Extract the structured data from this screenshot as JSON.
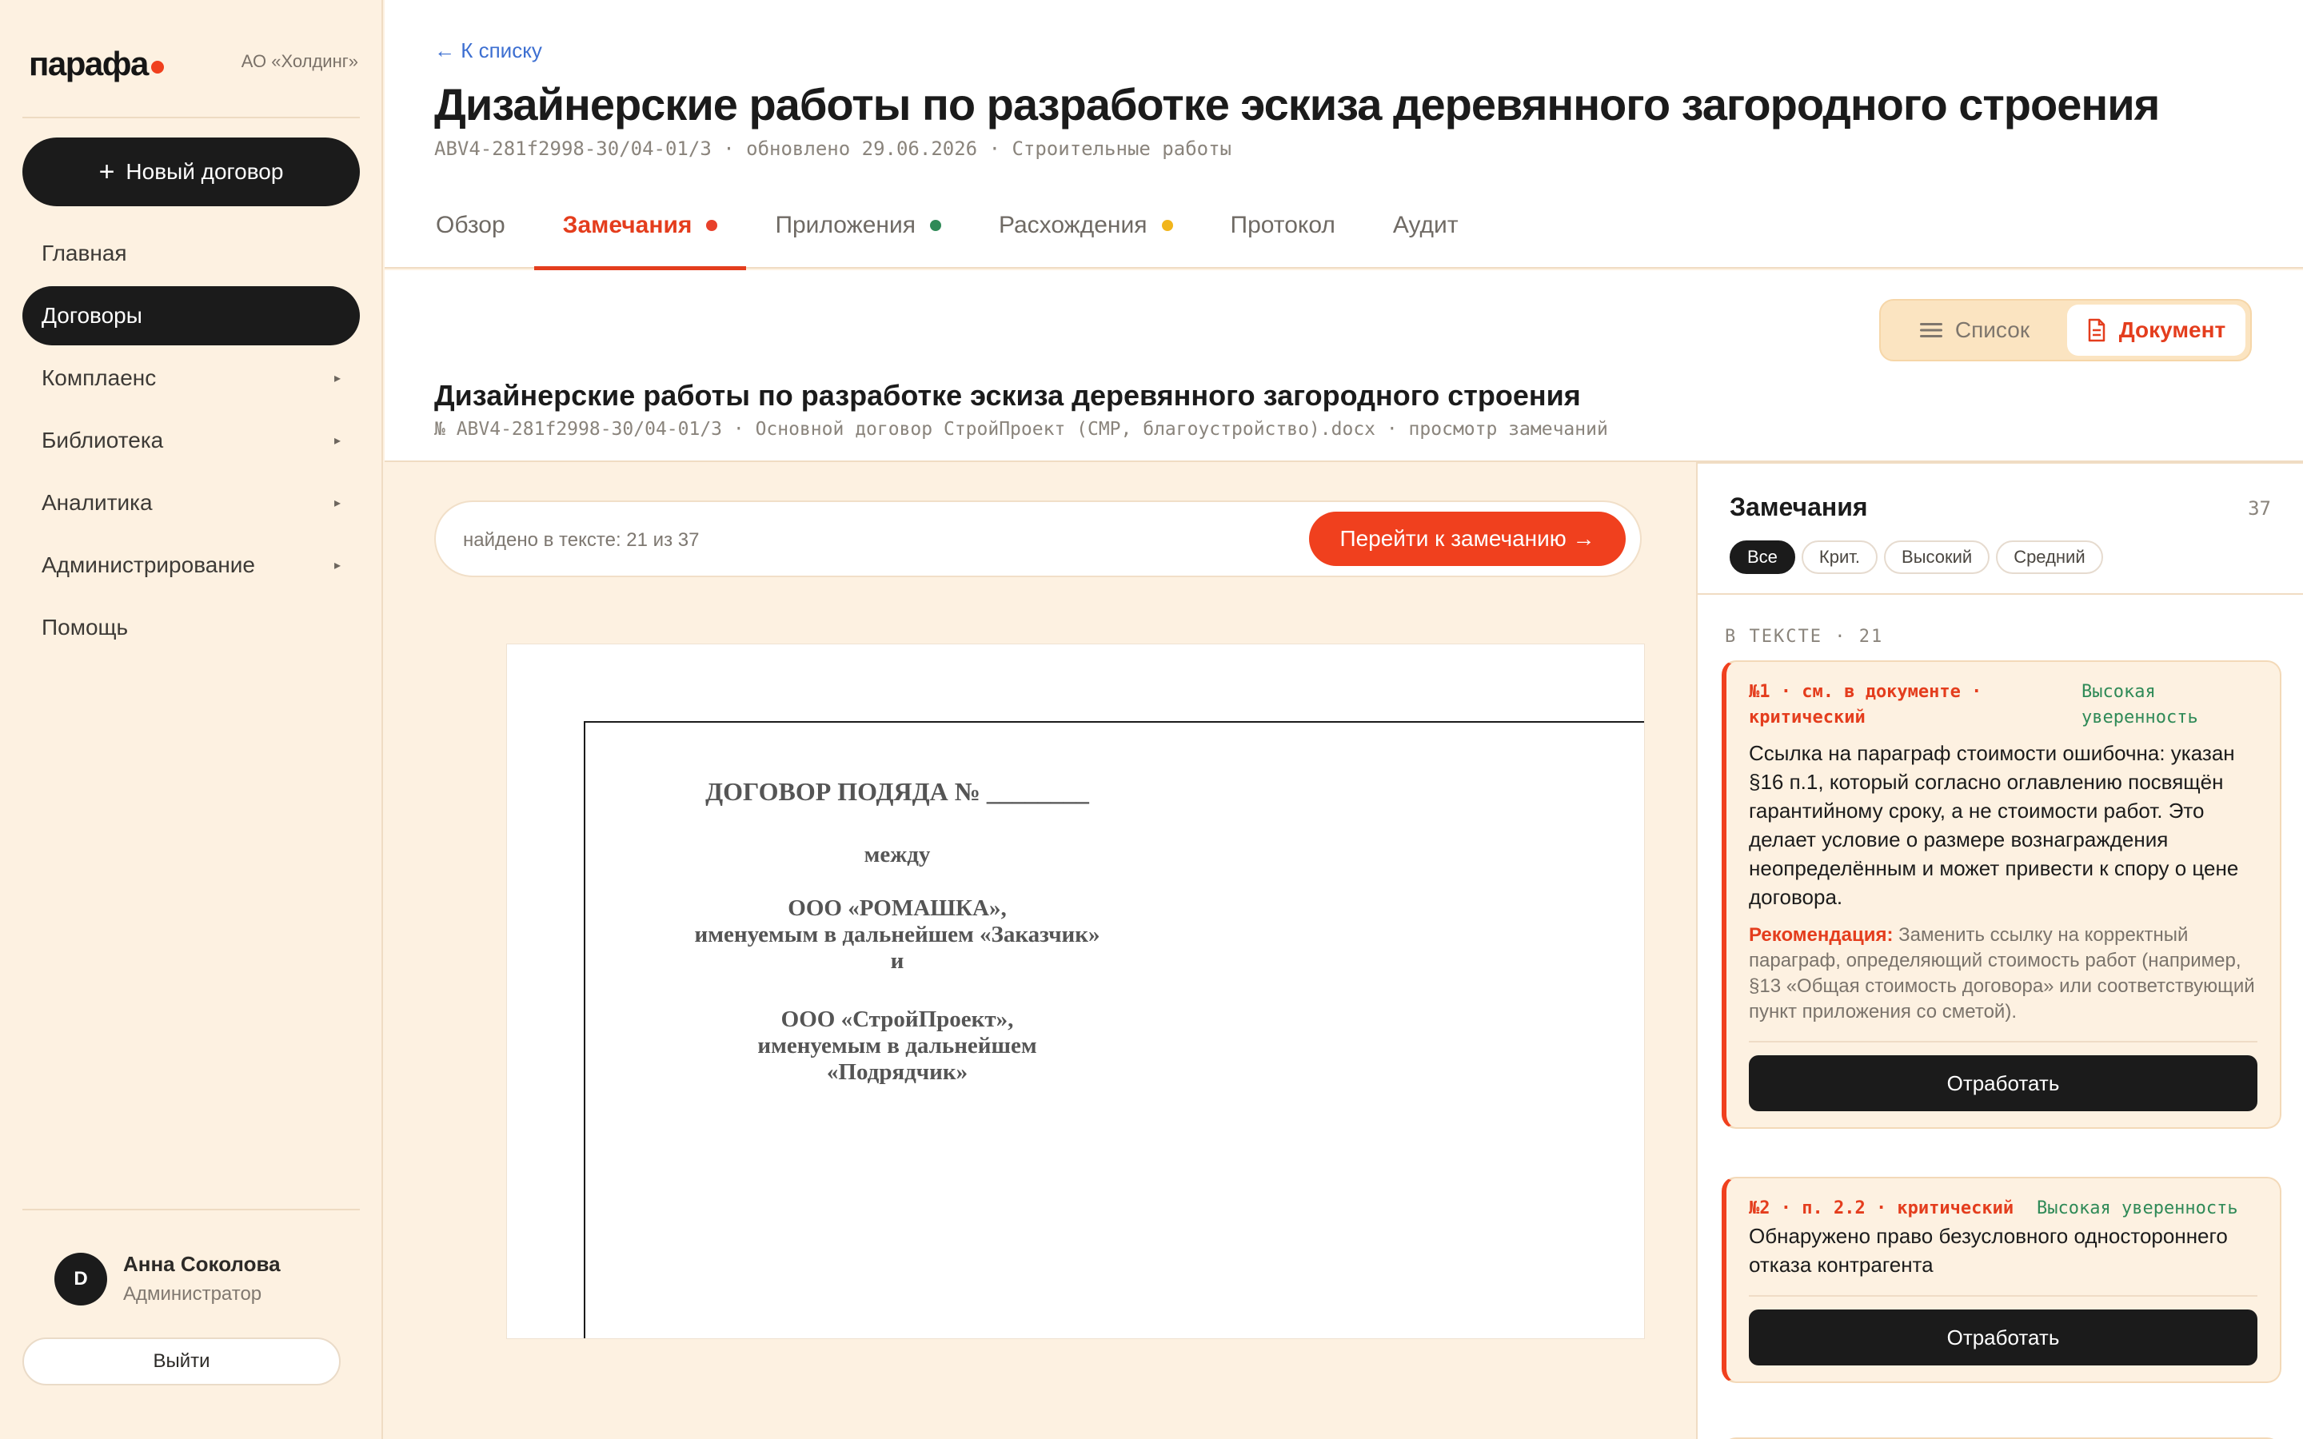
{
  "sidebar": {
    "logo": "парафа",
    "org": "АО «Холдинг»",
    "new_contract": "Новый договор",
    "items": [
      {
        "label": "Главная",
        "chevron": false
      },
      {
        "label": "Договоры",
        "chevron": false,
        "active": true
      },
      {
        "label": "Комплаенс",
        "chevron": true
      },
      {
        "label": "Библиотека",
        "chevron": true
      },
      {
        "label": "Аналитика",
        "chevron": true
      },
      {
        "label": "Администрирование",
        "chevron": true
      },
      {
        "label": "Помощь",
        "chevron": false
      }
    ],
    "user": {
      "initial": "D",
      "name": "Анна Соколова",
      "role": "Администратор"
    },
    "logout": "Выйти"
  },
  "header": {
    "back": "← К списку",
    "title": "Дизайнерские работы по разработке эскиза деревянного загородного строения",
    "meta": "ABV4-281f2998-30/04-01/3 · обновлено 29.06.2026 · Строительные работы",
    "tabs": [
      {
        "label": "Обзор",
        "dot": null
      },
      {
        "label": "Замечания",
        "dot": "#e8412b",
        "active": true
      },
      {
        "label": "Приложения",
        "dot": "#2f8a57"
      },
      {
        "label": "Расхождения",
        "dot": "#f1b51c"
      },
      {
        "label": "Протокол",
        "dot": null
      },
      {
        "label": "Аудит",
        "dot": null
      }
    ]
  },
  "view_toggle": {
    "list": "Список",
    "document": "Документ"
  },
  "doc_header": {
    "title": "Дизайнерские работы по разработке эскиза деревянного загородного строения",
    "meta": "№ ABV4-281f2998-30/04-01/3 · Основной договор СтройПроект (СМР, благоустройство).docx · просмотр замечаний"
  },
  "search": {
    "text": "найдено в тексте: 21 из 37",
    "goto": "Перейти к замечанию →"
  },
  "document": {
    "line1": "ДОГОВОР ПОДЯДА № ________",
    "line2": "между",
    "party1": [
      "ООО «РОМАШКА»,",
      "именуемым в дальнейшем «Заказчик»",
      "и"
    ],
    "party2": [
      "ООО «СтройПроект»,",
      "именуемым в дальнейшем",
      "«Подрядчик»"
    ]
  },
  "panel": {
    "title": "Замечания",
    "count": "37",
    "filters": [
      {
        "label": "Все",
        "active": true
      },
      {
        "label": "Крит."
      },
      {
        "label": "Высокий"
      },
      {
        "label": "Средний"
      }
    ],
    "section": "В ТЕКСТЕ · 21",
    "cards": [
      {
        "ref": "№1 · см. в документе · критический",
        "confidence": "Высокая уверенность",
        "body": "Ссылка на параграф стоимости ошибочна: указан §16 п.1, который согласно оглавлению посвящён гарантийному сроку, а не стоимости работ. Это делает условие о размере вознаграждения неопределённым и может привести к спору о цене договора.",
        "rec_label": "Рекомендация:",
        "rec_text": " Заменить ссылку на корректный параграф, определяющий стоимость работ (например, §13 «Общая стоимость договора» или соответствующий пункт приложения со сметой).",
        "button": "Отработать"
      },
      {
        "ref": "№2 · п. 2.2 · критический",
        "confidence": "Высокая уверенность",
        "body": "Обнаружено право безусловного одностороннего отказа контрагента",
        "button": "Отработать"
      }
    ]
  },
  "colors": {
    "accent": "#f0401e",
    "dark": "#1b1b1b",
    "background": "#fdf1e1",
    "confidence": "#2f8a57"
  }
}
